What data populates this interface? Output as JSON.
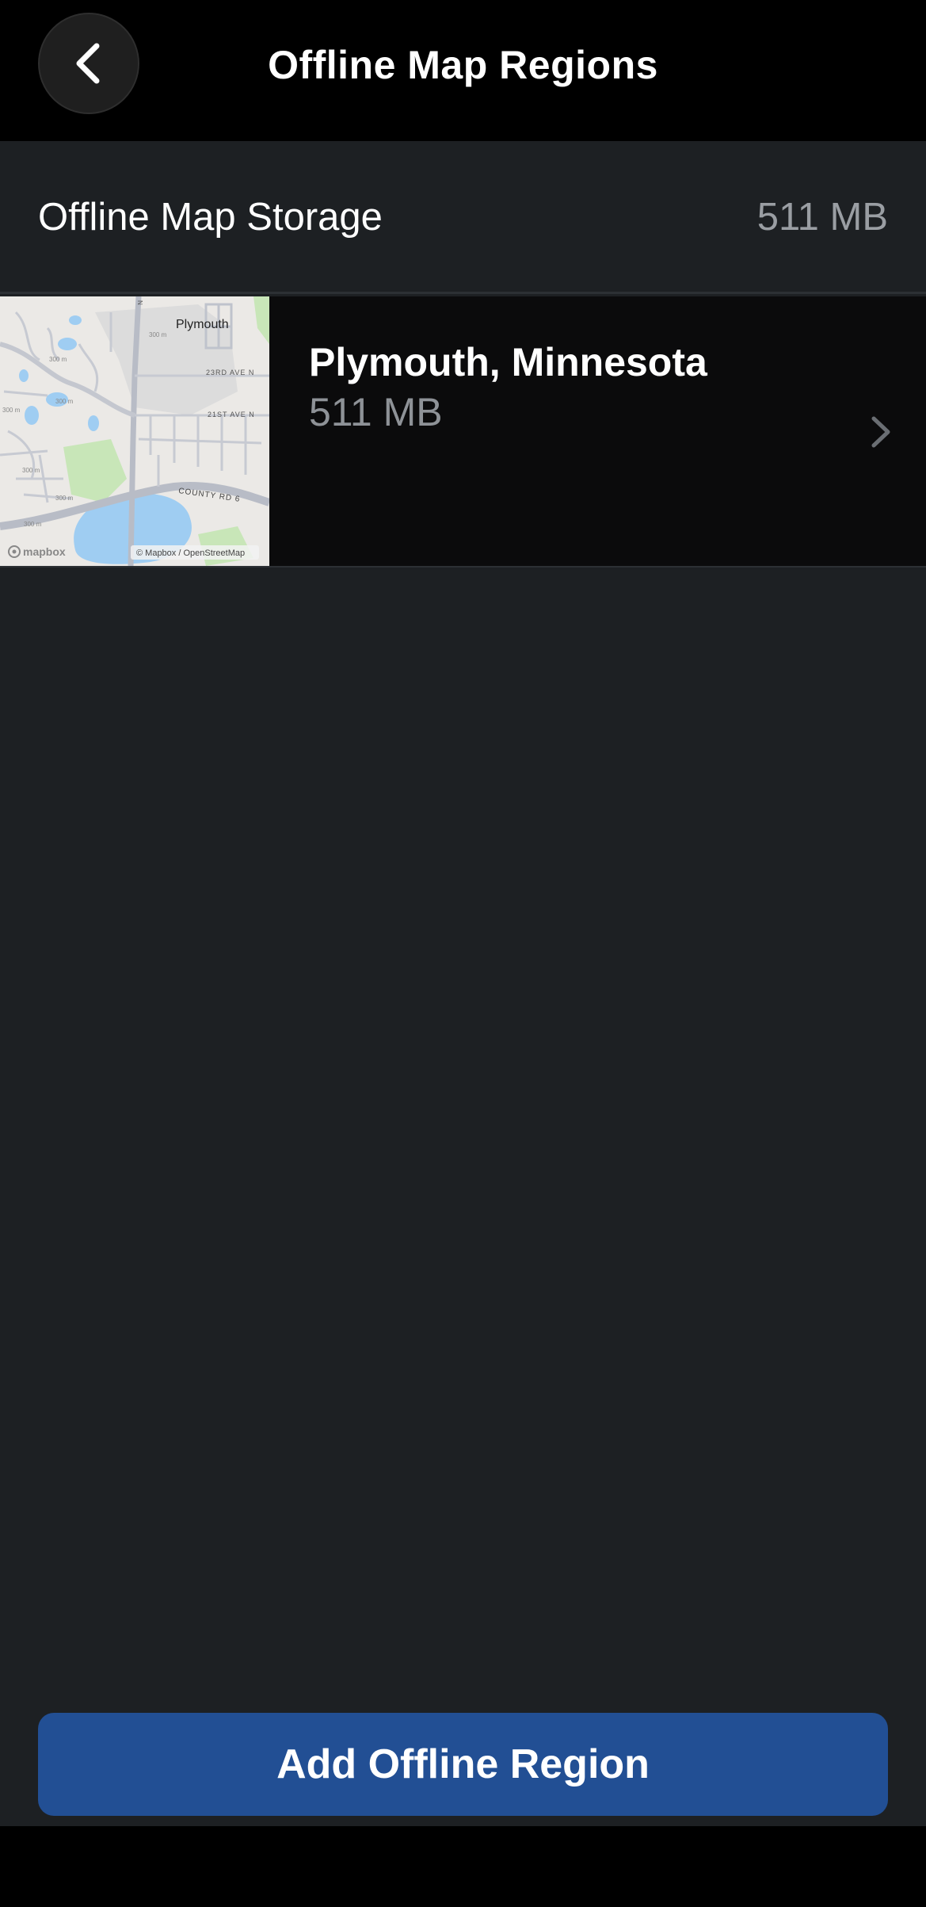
{
  "header": {
    "title": "Offline Map Regions",
    "back_icon": "chevron-left-icon"
  },
  "storage": {
    "label": "Offline Map Storage",
    "value": "511 MB"
  },
  "regions": [
    {
      "name": "Plymouth, Minnesota",
      "size": "511 MB",
      "map": {
        "place_label": "Plymouth",
        "road_labels": [
          "23RD AVE N",
          "21ST AVE N",
          "COUNTY RD 6"
        ],
        "contour_labels": [
          "300 m",
          "300 m",
          "300 m",
          "300 m",
          "300 m",
          "300 m",
          "300 m"
        ],
        "attribution": "© Mapbox / OpenStreetMap",
        "logo": "mapbox"
      },
      "chevron_icon": "chevron-right-icon"
    }
  ],
  "actions": {
    "add_label": "Add Offline Region"
  },
  "colors": {
    "background": "#1d2023",
    "header": "#000000",
    "accent_button": "#224f94",
    "secondary_text": "#9a9ea3"
  }
}
